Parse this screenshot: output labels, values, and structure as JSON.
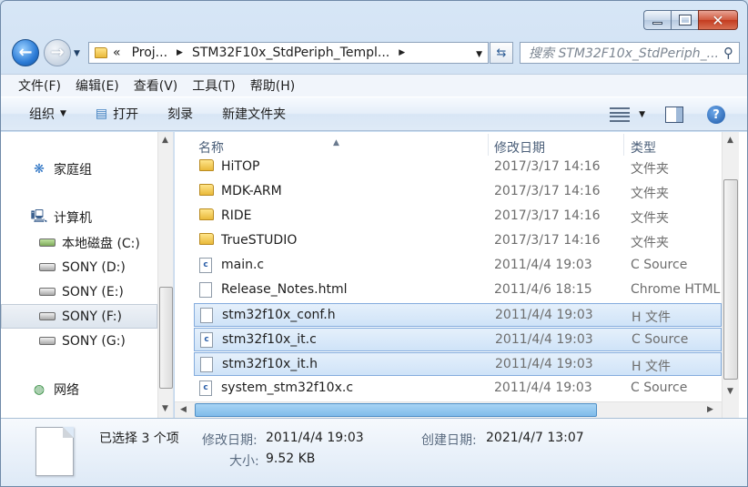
{
  "window": {
    "minimize_icon": "minimize-icon",
    "maximize_icon": "maximize-icon",
    "close_icon": "close-icon"
  },
  "address": {
    "overflow": "«",
    "crumbs": [
      "Proj...",
      "STM32F10x_StdPeriph_Templ..."
    ],
    "search_placeholder": "搜索 STM32F10x_StdPeriph_..."
  },
  "menu": [
    "文件(F)",
    "编辑(E)",
    "查看(V)",
    "工具(T)",
    "帮助(H)"
  ],
  "commands": {
    "organize": "组织",
    "open": "打开",
    "burn": "刻录",
    "new_folder": "新建文件夹"
  },
  "nav": {
    "homegroup": "家庭组",
    "computer": "计算机",
    "drives": [
      {
        "label": "本地磁盘 (C:)",
        "selected": false
      },
      {
        "label": "SONY (D:)",
        "selected": false
      },
      {
        "label": "SONY (E:)",
        "selected": false
      },
      {
        "label": "SONY (F:)",
        "selected": true
      },
      {
        "label": "SONY (G:)",
        "selected": false
      }
    ],
    "network": "网络"
  },
  "columns": {
    "name": "名称",
    "date": "修改日期",
    "type": "类型"
  },
  "files": [
    {
      "name": "HiTOP",
      "date": "2017/3/17 14:16",
      "type": "文件夹",
      "icon": "folder-icon",
      "selected": false
    },
    {
      "name": "MDK-ARM",
      "date": "2017/3/17 14:16",
      "type": "文件夹",
      "icon": "folder-icon",
      "selected": false
    },
    {
      "name": "RIDE",
      "date": "2017/3/17 14:16",
      "type": "文件夹",
      "icon": "folder-icon",
      "selected": false
    },
    {
      "name": "TrueSTUDIO",
      "date": "2017/3/17 14:16",
      "type": "文件夹",
      "icon": "folder-icon",
      "selected": false
    },
    {
      "name": "main.c",
      "date": "2011/4/4 19:03",
      "type": "C Source",
      "icon": "c-file-icon",
      "selected": false
    },
    {
      "name": "Release_Notes.html",
      "date": "2011/4/6 18:15",
      "type": "Chrome HTML",
      "icon": "html-file-icon",
      "selected": false
    },
    {
      "name": "stm32f10x_conf.h",
      "date": "2011/4/4 19:03",
      "type": "H 文件",
      "icon": "h-file-icon",
      "selected": true
    },
    {
      "name": "stm32f10x_it.c",
      "date": "2011/4/4 19:03",
      "type": "C Source",
      "icon": "c-file-icon",
      "selected": true
    },
    {
      "name": "stm32f10x_it.h",
      "date": "2011/4/4 19:03",
      "type": "H 文件",
      "icon": "h-file-icon",
      "selected": true
    },
    {
      "name": "system_stm32f10x.c",
      "date": "2011/4/4 19:03",
      "type": "C Source",
      "icon": "c-file-icon",
      "selected": false
    }
  ],
  "details": {
    "selection": "已选择 3 个项",
    "modified_label": "修改日期:",
    "modified_value": "2011/4/4 19:03",
    "created_label": "创建日期:",
    "created_value": "2021/4/7 13:07",
    "size_label": "大小:",
    "size_value": "9.52 KB"
  }
}
